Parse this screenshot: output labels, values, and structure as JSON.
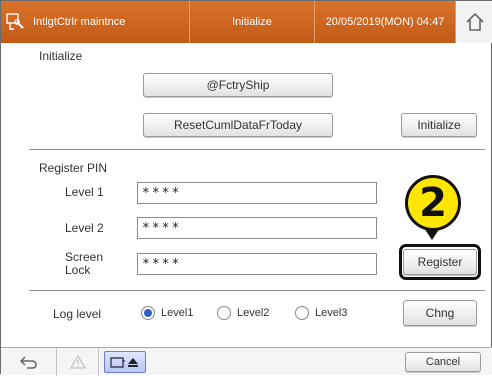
{
  "header": {
    "app_title": "IntlgtCtrlr maintnce",
    "screen_title": "Initialize",
    "datetime": "20/05/2019(MON) 04:47",
    "icons": {
      "app": "plug-wrench-icon",
      "home": "home-icon"
    }
  },
  "initialize_section": {
    "label": "Initialize",
    "factory_ship_label": "@FctryShip",
    "reset_cumulative_label": "ResetCumlDataFrToday",
    "initialize_button_label": "Initialize"
  },
  "register_pin_section": {
    "label": "Register PIN",
    "rows": [
      {
        "label": "Level 1",
        "value": "****"
      },
      {
        "label": "Level 2",
        "value": "****"
      },
      {
        "label_line1": "Screen",
        "label_line2": "Lock",
        "value": "****"
      }
    ],
    "register_button_label": "Register"
  },
  "log_level_section": {
    "label": "Log level",
    "options": [
      "Level1",
      "Level2",
      "Level3"
    ],
    "selected": "Level1",
    "change_button_label": "Chng"
  },
  "callout": {
    "number": "2"
  },
  "footer": {
    "icons": [
      "back-icon",
      "warning-icon",
      "media-eject-icon"
    ],
    "cancel_label": "Cancel"
  }
}
